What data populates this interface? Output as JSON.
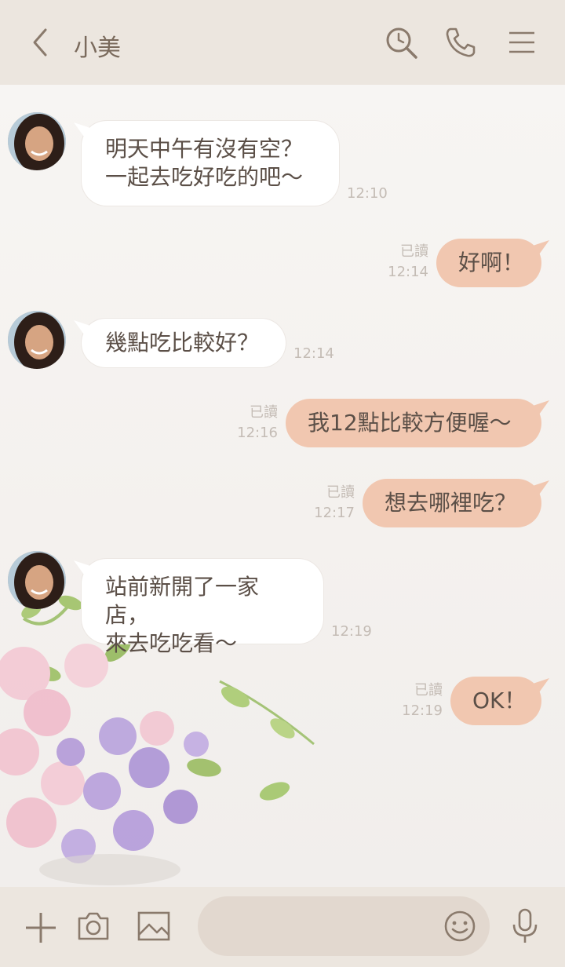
{
  "header": {
    "title": "小美"
  },
  "messages": [
    {
      "side": "in",
      "text": "明天中午有沒有空？\n一起去吃好吃的吧～",
      "time": "12:10"
    },
    {
      "side": "out",
      "text": "好啊！",
      "read": "已讀",
      "time": "12:14"
    },
    {
      "side": "in",
      "text": "幾點吃比較好？",
      "time": "12:14"
    },
    {
      "side": "out",
      "text": "我12點比較方便喔～",
      "read": "已讀",
      "time": "12:16"
    },
    {
      "side": "out",
      "text": "想去哪裡吃？",
      "read": "已讀",
      "time": "12:17"
    },
    {
      "side": "in",
      "text": "站前新開了一家店，\n來去吃吃看～",
      "time": "12:19"
    },
    {
      "side": "out",
      "text": "OK！",
      "read": "已讀",
      "time": "12:19"
    }
  ],
  "input": {
    "placeholder": ""
  },
  "colors": {
    "header_bg": "#ece6df",
    "outgoing_bubble": "#f1c7b0",
    "incoming_bubble": "#ffffff",
    "text": "#5b4f47"
  },
  "icons": [
    "back-icon",
    "search-icon",
    "phone-icon",
    "menu-icon",
    "plus-icon",
    "camera-icon",
    "image-icon",
    "emoji-icon",
    "microphone-icon"
  ]
}
